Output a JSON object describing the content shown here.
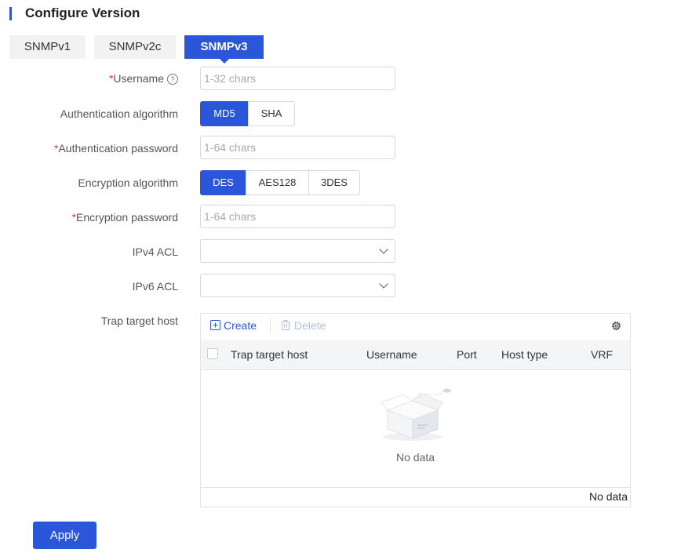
{
  "page": {
    "title": "Configure Version"
  },
  "version_tabs": [
    {
      "label": "SNMPv1",
      "active": false
    },
    {
      "label": "SNMPv2c",
      "active": false
    },
    {
      "label": "SNMPv3",
      "active": true
    }
  ],
  "form": {
    "username": {
      "required_mark": "*",
      "label": "Username",
      "help": "?",
      "placeholder": "1-32 chars",
      "value": ""
    },
    "auth_algorithm": {
      "label": "Authentication algorithm",
      "options": [
        "MD5",
        "SHA"
      ],
      "selected": "MD5"
    },
    "auth_password": {
      "required_mark": "*",
      "label": "Authentication password",
      "placeholder": "1-64 chars",
      "value": ""
    },
    "enc_algorithm": {
      "label": "Encryption algorithm",
      "options": [
        "DES",
        "AES128",
        "3DES"
      ],
      "selected": "DES"
    },
    "enc_password": {
      "required_mark": "*",
      "label": "Encryption password",
      "placeholder": "1-64 chars",
      "value": ""
    },
    "ipv4_acl": {
      "label": "IPv4 ACL",
      "value": ""
    },
    "ipv6_acl": {
      "label": "IPv6 ACL",
      "value": ""
    },
    "trap_target_host": {
      "label": "Trap target host"
    }
  },
  "trap_table": {
    "toolbar": {
      "create": "Create",
      "delete": "Delete"
    },
    "columns": [
      "Trap target host",
      "Username",
      "Port",
      "Host type",
      "VRF"
    ],
    "rows": [],
    "empty_text": "No data",
    "footer_text": "No data"
  },
  "actions": {
    "apply": "Apply"
  },
  "colors": {
    "accent": "#2b56d9",
    "required": "#e53935"
  }
}
